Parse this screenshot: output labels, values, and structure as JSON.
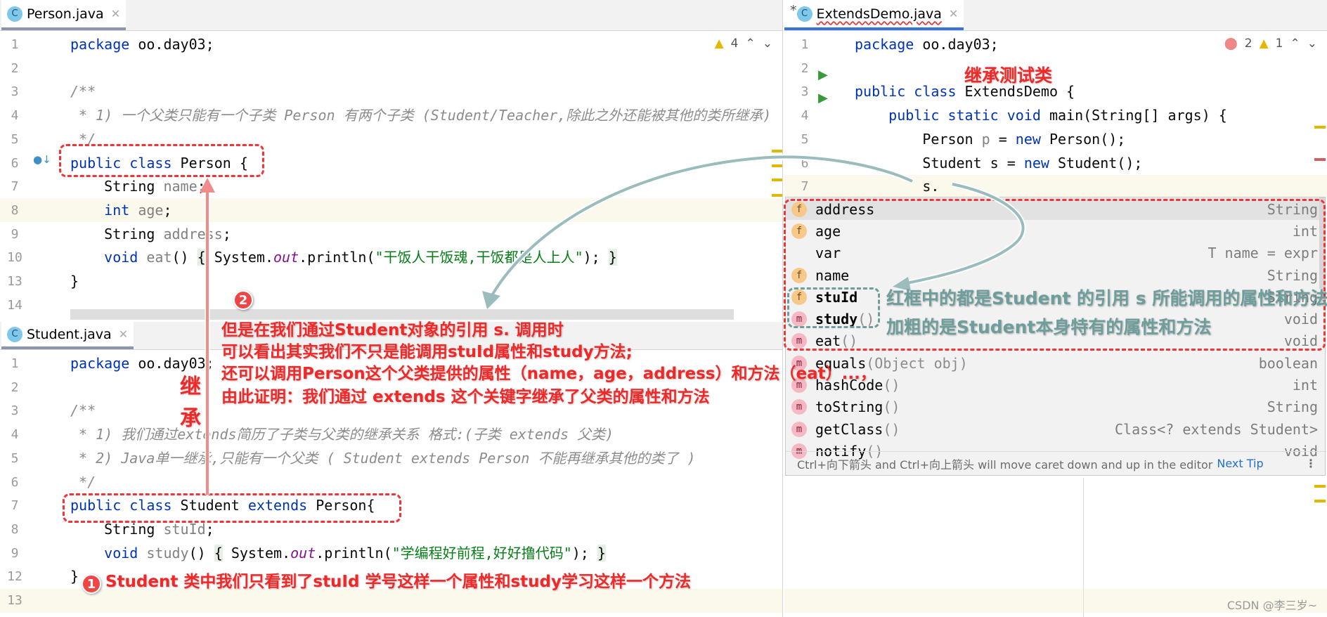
{
  "person": {
    "tab": "Person.java",
    "warnings": "4",
    "lines": [
      {
        "n": "1",
        "t": [
          [
            "package",
            "kw"
          ],
          [
            " oo.day03;",
            ""
          ]
        ]
      },
      {
        "n": "2",
        "t": []
      },
      {
        "n": "3",
        "t": [
          [
            "/**",
            "cmt"
          ]
        ]
      },
      {
        "n": "4",
        "t": [
          [
            " * 1) 一个父类只能有一个子类 Person 有两个子类 (Student/Teacher,除此之外还能被其他的类所继承)",
            "cmt"
          ]
        ]
      },
      {
        "n": "5",
        "t": [
          [
            " */",
            "cmt"
          ]
        ]
      },
      {
        "n": "6",
        "t": [
          [
            "public class ",
            "kw"
          ],
          [
            "Person {",
            ""
          ]
        ]
      },
      {
        "n": "7",
        "t": [
          [
            "    String ",
            ""
          ],
          [
            "name",
            "field"
          ],
          [
            ";",
            ""
          ]
        ]
      },
      {
        "n": "8",
        "t": [
          [
            "    ",
            ""
          ],
          [
            "int ",
            "kw"
          ],
          [
            "age",
            "field"
          ],
          [
            ";",
            ""
          ]
        ]
      },
      {
        "n": "9",
        "t": [
          [
            "    String ",
            ""
          ],
          [
            "address",
            "field"
          ],
          [
            ";",
            ""
          ]
        ]
      },
      {
        "n": "10",
        "t": [
          [
            "    ",
            ""
          ],
          [
            "void ",
            "kw"
          ],
          [
            "eat",
            "field"
          ],
          [
            "() ",
            ""
          ],
          [
            "{",
            "brace"
          ],
          [
            " System.",
            ""
          ],
          [
            "out",
            "static"
          ],
          [
            ".println(",
            ""
          ],
          [
            "\"干饭人干饭魂,干饭都是人上人\"",
            "str"
          ],
          [
            "); ",
            ""
          ],
          [
            "}",
            "brace"
          ]
        ]
      },
      {
        "n": "13",
        "t": [
          [
            "}",
            ""
          ]
        ]
      },
      {
        "n": "14",
        "t": []
      }
    ]
  },
  "student": {
    "tab": "Student.java",
    "lines": [
      {
        "n": "1",
        "t": [
          [
            "package",
            "kw"
          ],
          [
            " oo.day03;",
            ""
          ]
        ]
      },
      {
        "n": "2",
        "t": []
      },
      {
        "n": "3",
        "t": [
          [
            "/**",
            "cmt"
          ]
        ]
      },
      {
        "n": "4",
        "t": [
          [
            " * 1) 我们通过extends简历了子类与父类的继承关系 格式:(子类 extends 父类)",
            "cmt"
          ]
        ]
      },
      {
        "n": "5",
        "t": [
          [
            " * 2) Java单一继承,只能有一个父类 ( Student extends Person 不能再继承其他的类了 )",
            "cmt"
          ]
        ]
      },
      {
        "n": "6",
        "t": [
          [
            " */",
            "cmt"
          ]
        ]
      },
      {
        "n": "7",
        "t": [
          [
            "public class ",
            "kw"
          ],
          [
            "Student ",
            ""
          ],
          [
            "extends ",
            "kw"
          ],
          [
            "Person{",
            ""
          ]
        ]
      },
      {
        "n": "8",
        "t": [
          [
            "    String ",
            ""
          ],
          [
            "stuId",
            "field"
          ],
          [
            ";",
            ""
          ]
        ]
      },
      {
        "n": "9",
        "t": [
          [
            "    ",
            ""
          ],
          [
            "void ",
            "kw"
          ],
          [
            "study",
            "field"
          ],
          [
            "() ",
            ""
          ],
          [
            "{",
            "brace"
          ],
          [
            " System.",
            ""
          ],
          [
            "out",
            "static"
          ],
          [
            ".println(",
            ""
          ],
          [
            "\"学编程好前程,好好撸代码\"",
            "str"
          ],
          [
            "); ",
            ""
          ],
          [
            "}",
            "brace"
          ]
        ]
      },
      {
        "n": "12",
        "t": [
          [
            "}",
            ""
          ]
        ]
      },
      {
        "n": "13",
        "t": []
      }
    ]
  },
  "demo": {
    "tab": "ExtendsDemo.java",
    "modified": "*",
    "errors": "2",
    "warnings": "1",
    "lines": [
      {
        "n": "1",
        "t": [
          [
            "package",
            "kw"
          ],
          [
            " oo.day03;",
            ""
          ]
        ]
      },
      {
        "n": "2",
        "t": []
      },
      {
        "n": "3",
        "t": [
          [
            "public class ",
            "kw"
          ],
          [
            "ExtendsDemo {",
            ""
          ]
        ]
      },
      {
        "n": "4",
        "t": [
          [
            "    ",
            ""
          ],
          [
            "public static void ",
            "kw"
          ],
          [
            "main(String[] args) {",
            ""
          ]
        ]
      },
      {
        "n": "5",
        "t": [
          [
            "        Person ",
            ""
          ],
          [
            "p",
            "field"
          ],
          [
            " = ",
            ""
          ],
          [
            "new ",
            "kw"
          ],
          [
            "Person();",
            ""
          ]
        ]
      },
      {
        "n": "6",
        "t": [
          [
            "        Student s = ",
            ""
          ],
          [
            "new ",
            "kw"
          ],
          [
            "Student();",
            ""
          ]
        ]
      },
      {
        "n": "7",
        "t": [
          [
            "        s.",
            ""
          ]
        ]
      }
    ]
  },
  "completion": {
    "items": [
      {
        "icon": "f",
        "name": "address",
        "params": "",
        "type": "String"
      },
      {
        "icon": "f",
        "name": "age",
        "params": "",
        "type": "int"
      },
      {
        "icon": "",
        "name": "var",
        "params": "",
        "type": "T name = expr"
      },
      {
        "icon": "f",
        "name": "name",
        "params": "",
        "type": "String"
      },
      {
        "icon": "f",
        "name": "stuId",
        "params": "",
        "type": "String"
      },
      {
        "icon": "m",
        "name": "study",
        "params": "()",
        "type": "void"
      },
      {
        "icon": "m",
        "name": "eat",
        "params": "()",
        "type": "void"
      },
      {
        "icon": "m",
        "name": "equals",
        "params": "(Object obj)",
        "type": "boolean"
      },
      {
        "icon": "m",
        "name": "hashCode",
        "params": "()",
        "type": "int"
      },
      {
        "icon": "m",
        "name": "toString",
        "params": "()",
        "type": "String"
      },
      {
        "icon": "m",
        "name": "getClass",
        "params": "()",
        "type": "Class<? extends Student>"
      },
      {
        "icon": "m",
        "name": "notify",
        "params": "()",
        "type": "void"
      }
    ],
    "footer": "Ctrl+向下箭头 and Ctrl+向上箭头 will move caret down and up in the editor",
    "next_tip": "Next Tip"
  },
  "annotations": {
    "demo_label": "继承测试类",
    "inherit_1": "继",
    "inherit_2": "承",
    "badge_1": "1",
    "badge_2": "2",
    "note_2": [
      "但是在我们通过Student对象的引用 s. 调用时",
      "可以看出其实我们不只是能调用stuId属性和study方法;",
      "还可以调用Person这个父类提供的属性（name，age，address）和方法（eat）...，",
      "由此证明：我们通过 extends 这个关键字继承了父类的属性和方法"
    ],
    "note_1": "Student 类中我们只看到了stuId 学号这样一个属性和study学习这样一个方法",
    "popup_note_1": "红框中的都是Student 的引用 s 所能调用的属性和方法",
    "popup_note_2": "加粗的是Student本身特有的属性和方法"
  },
  "watermark": "CSDN @李三岁~",
  "colors": {
    "keyword": "#0033b3",
    "string": "#067d17",
    "annotation_red": "#f02828",
    "annotation_teal": "#6e9e9c"
  }
}
